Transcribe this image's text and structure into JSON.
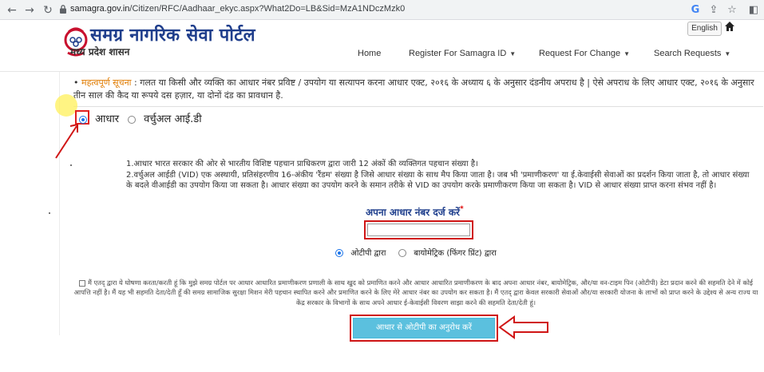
{
  "browser": {
    "url_host": "samagra.gov.in",
    "url_path": "/Citizen/RFC/Aadhaar_ekyc.aspx?What2Do=LB&Sid=MzA1NDczMzk0"
  },
  "header": {
    "title": "समग्र नागरिक सेवा पोर्टल",
    "subtitle": "मध्य प्रदेश शासन",
    "lang_button": "English",
    "menu": {
      "home": "Home",
      "register": "Register For Samagra ID",
      "request": "Request For Change",
      "search": "Search Requests"
    }
  },
  "notice": {
    "label": "महत्वपूर्ण सूचना",
    "text": ": गलत या किसी और व्यक्ति का आधार नंबर प्रविष्ट / उपयोग या सत्यापन करना आधार एक्ट, २०१६ के अध्याय ६ के अनुसार दंडनीय अपराध है | ऐसे अपराध के लिए आधार एक्ट, २०१६ के अनुसार तीन साल की कैद या रूपये दस हज़ार, या दोनों दंड का प्रावधान है."
  },
  "id_type": {
    "aadhaar": "आधार",
    "vid": "वर्चुअल आई.डी",
    "selected": "aadhaar"
  },
  "info": {
    "line1": "1.आधार भारत सरकार की ओर से भारतीय विशिष्ट पहचान प्राधिकरण द्वारा जारी 12 अंकों की व्यक्तिगत पहचान संख्या है।",
    "line2": "2.वर्चुअल आईडी (VID) एक अस्थायी, प्रतिसंहरणीय 16-अंकीय 'रैंडम' संख्या है जिसे आधार संख्या के साथ मैप किया जाता है। जब भी 'प्रमाणीकरण' या ई.केवाईसी सेवाओं का प्रदर्शन किया जाता है, तो आधार संख्या के बदले वीआईडी का उपयोग किया जा सकता है। आधार संख्या का उपयोग करने के समान तरीके से VID का उपयोग करके प्रमाणीकरण किया जा सकता है। VID से आधार संख्या प्राप्त करना संभव नहीं है।"
  },
  "aadhaar_field": {
    "label": "अपना आधार नंबर दर्ज करें",
    "required_mark": "*",
    "value": ""
  },
  "auth_method": {
    "otp": "ओटीपी द्वारा",
    "biometric": "बायोमेट्रिक (फिंगर प्रिंट) द्वारा",
    "selected": "otp"
  },
  "consent": {
    "text": "मैं एतद् द्वारा ये घोषणा करता/करती हूं कि मुझे समग्र पोर्टल पर आधार आधारित प्रमाणीकरण प्रणाली के साथ खुद को प्रमाणित करने और आधार आधारित प्रमाणीकरण के बाद अपना आधार नंबर, बायोमेट्रिक, और/या वन-टाइम पिन (ओटीपी) डेटा प्रदान करने की सहमति देने में कोई आपत्ति नहीं है। मैं यह भी सहमति देता/देती हूँ की समग्र सामाजिक सुरक्षा मिशन मेरी पहचान स्थापित करने और प्रमाणित करने के लिए मेरे आधार नंबर का उपयोग कर सकता है। मैं एतद् द्वारा केवल सरकारी सेवाओं और/या सरकारी योजना के लाभों को प्राप्त करने के उद्देश्य से अन्य राज्य या केंद्र सरकार के विभागों के साथ अपने आधार ई-केवाईसी विवरण साझा करने की सहमति देता/देती हूं।"
  },
  "submit": {
    "label": "आधार से ओटीपी का अनुरोध करें"
  },
  "colors": {
    "brand_blue": "#1f3e8c",
    "highlight_red": "#d01515",
    "button_blue": "#5bc0de",
    "notice_orange": "#e07b00"
  }
}
